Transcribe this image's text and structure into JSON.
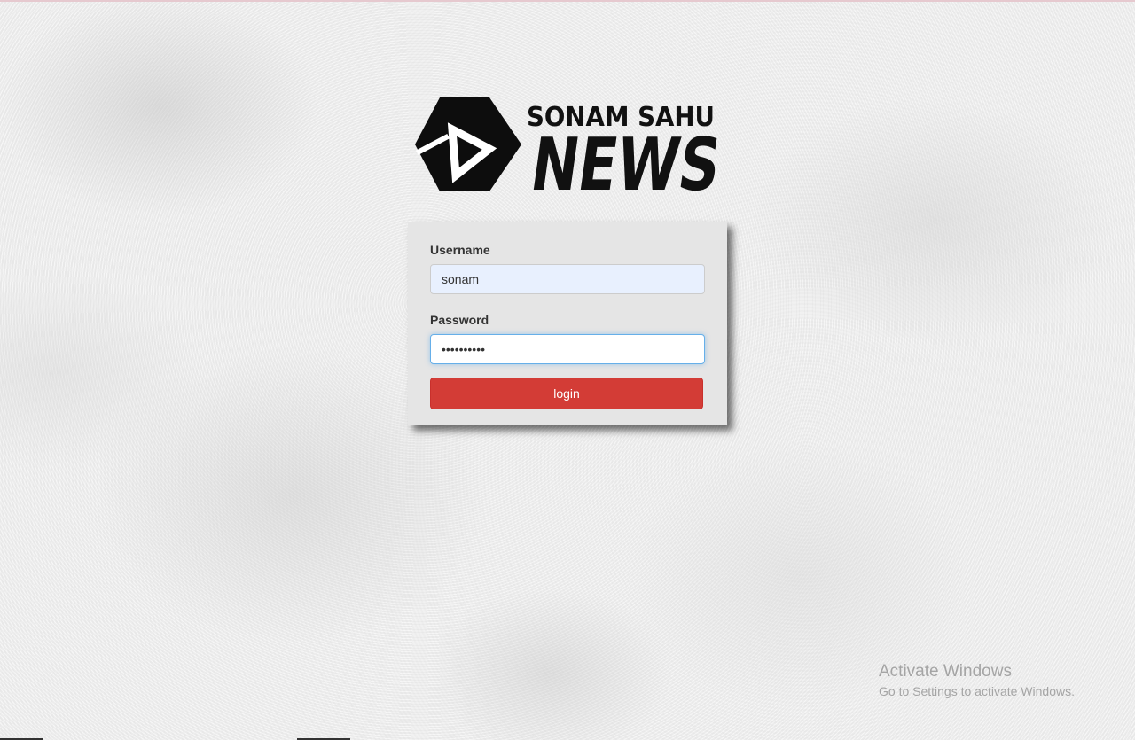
{
  "branding": {
    "logo_line1": "SONAM SAHU",
    "logo_line2": "NEWS"
  },
  "login_form": {
    "username_label": "Username",
    "username_value": "sonam",
    "password_label": "Password",
    "password_value": "••••••••••",
    "submit_label": "login"
  },
  "watermark": {
    "title": "Activate Windows",
    "subtitle": "Go to Settings to activate Windows."
  },
  "colors": {
    "button": "#d33c36",
    "panel": "#e5e5e5",
    "autofill": "#e8f0fe",
    "focus_ring": "#66afe9"
  }
}
